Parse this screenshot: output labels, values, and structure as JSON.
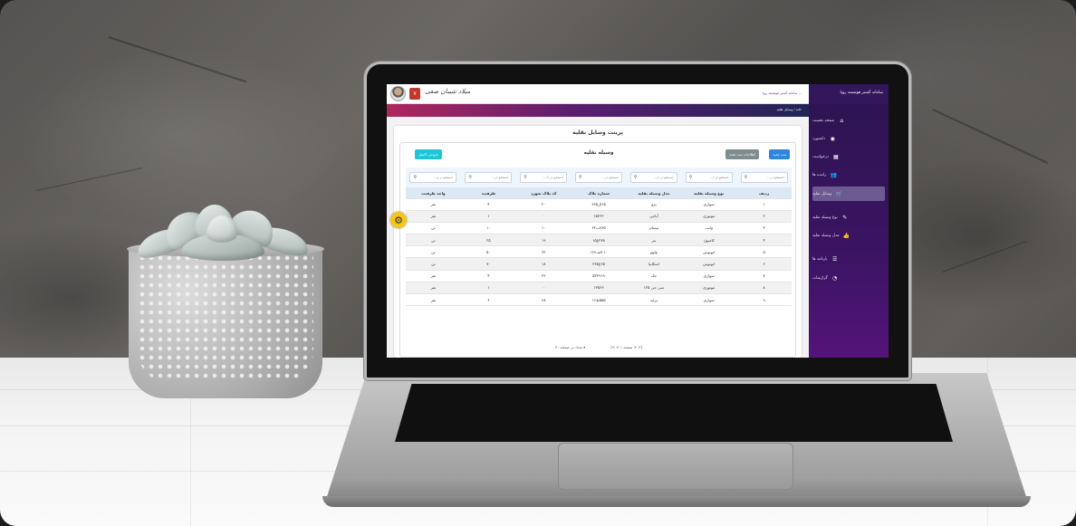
{
  "app": {
    "system_title": "سامانه گستر هوشمند رویا",
    "notice": "سامانه گستر هوشمند رویا   ...",
    "user_name": "میلاد شیبان صفی",
    "badge": "۷",
    "breadcrumb": "خانه / وسایل نقلیه"
  },
  "sidebar": {
    "items": [
      {
        "label": "صفحه نخست",
        "icon": "home-icon",
        "glyph": "⌂",
        "active": false
      },
      {
        "label": "داشبورد",
        "icon": "dashboard-icon",
        "glyph": "◉",
        "active": false
      },
      {
        "label": "درخواست",
        "icon": "calendar-icon",
        "glyph": "▦",
        "active": false
      },
      {
        "label": "راننده ها",
        "icon": "users-icon",
        "glyph": "👥",
        "active": false
      },
      {
        "label": "وسایل نقلیه",
        "icon": "cart-icon",
        "glyph": "🛒",
        "active": true
      },
      {
        "label": "نوع وسیله نقلیه",
        "icon": "pencil-icon",
        "glyph": "✎",
        "active": false
      },
      {
        "label": "مدل وسیله نقلیه",
        "icon": "thumbs-up-icon",
        "glyph": "👍",
        "active": false
      },
      {
        "label": "بارنامه ها",
        "icon": "list-icon",
        "glyph": "☰",
        "active": false
      },
      {
        "label": "گزارشات",
        "icon": "chart-icon",
        "glyph": "◔",
        "active": false
      }
    ]
  },
  "page": {
    "title": "پرینت وسایل نقلیه",
    "card_title": "وسیله نقلیه",
    "buttons": {
      "new": "ثبت جدید",
      "info": "اطلاعات ثبت شده",
      "excel": "خروجی اکسل"
    },
    "search_placeholders": [
      "جستجو در...",
      "جستجو در ا...",
      "جستجو در م...",
      "جستجو در...",
      "جستجو در ک...",
      "جستجو در...",
      "جستجو در و..."
    ],
    "columns": [
      "ردیف",
      "نوع وسیله نقلیه",
      "مدل وسیله نقلیه",
      "شماره پلاک",
      "کد پلاک شهرد",
      "ظرفیت",
      "واحد ظرفیت"
    ],
    "rows": [
      [
        "۱",
        "سواری",
        "پژو",
        "۱۵ال۳۶۵",
        "۲۰",
        "۴",
        "نفر"
      ],
      [
        "۲",
        "موتوری",
        "آپاچی",
        "۱۵۳۶۲",
        "۰",
        "۱",
        "نفر"
      ],
      [
        "۳",
        "وانت",
        "نیسان",
        "۶۶۵ب۶۲",
        "۱۰",
        "۱۰",
        "تن"
      ],
      [
        "۴",
        "کامیون",
        "بنز",
        "۲۷۸ع۱۵",
        "۱۹",
        "۲۵",
        "تن"
      ],
      [
        "۵",
        "اتوبوس",
        "ولوو",
        "۱۰ الف۱۶۶",
        "۶۲",
        "۵۰",
        "تن"
      ],
      [
        "۶",
        "اتوبوس",
        "اسکانیا",
        "۶۵ع۳۶۵",
        "۱۸",
        "۷۰",
        "تن"
      ],
      [
        "۷",
        "سواری",
        "جک",
        "۵۲۲۹۱۹",
        "۲۲",
        "۴",
        "نفر"
      ],
      [
        "۸",
        "موتوری",
        "سی جی ۱۲۵",
        "۱۳۵۶۶",
        "۰",
        "۱",
        "نفر"
      ],
      [
        "۹",
        "سواری",
        "پراید",
        "۵۵۵ط۱۶",
        "۶۸",
        "۶",
        "نفر"
      ]
    ],
    "pager": {
      "pages": "|< < ۱ صفحه > >|",
      "page_size_label": "تعداد در صفحه",
      "page_size": "۳۰"
    }
  },
  "colors": {
    "sidebar": "#3b1463",
    "btn_new": "#2e86de",
    "btn_info": "#7f8c8d",
    "btn_excel": "#1ec7d6",
    "settings_gear": "#f5c518"
  }
}
